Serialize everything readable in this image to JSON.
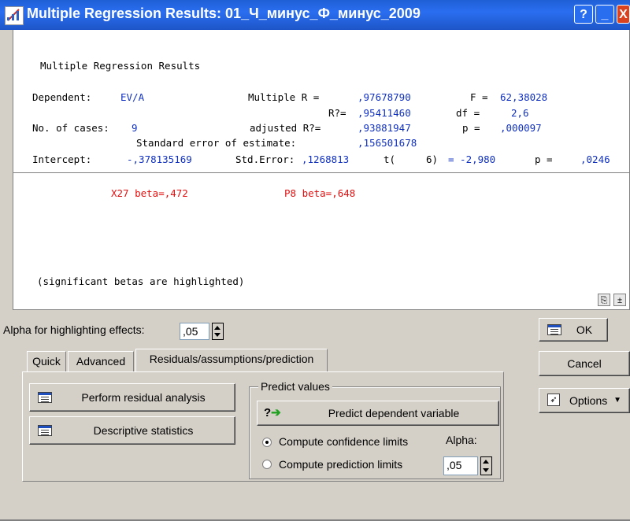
{
  "window": {
    "title": "Multiple Regression Results: 01_Ч_минус_Ф_минус_2009",
    "help": "?",
    "minimize": "_",
    "close": "X"
  },
  "output": {
    "header": "Multiple Regression Results",
    "dependent_label": "Dependent:",
    "dependent_value": "EV/A",
    "multiple_r_label": "Multiple R =",
    "multiple_r_value": ",97678790",
    "f_label": "F =",
    "f_value": "62,38028",
    "r2_label": "R?=",
    "r2_value": ",95411460",
    "df_label": "df =",
    "df_value": "2,6",
    "cases_label": "No. of cases:",
    "cases_value": "9",
    "adj_r2_label": "adjusted R?=",
    "adj_r2_value": ",93881947",
    "p_label": "p =",
    "p_value": ",000097",
    "se_label": "Standard error of estimate:",
    "se_value": ",156501678",
    "intercept_label": "Intercept:",
    "intercept_value": "-,378135169",
    "std_error_label": "Std.Error:",
    "std_error_value": ",1268813",
    "t_label": "t(",
    "t_df": "6)",
    "t_value": "= -2,980",
    "p2_label": "p =",
    "p2_value": ",0246",
    "beta1": "X27 beta=,472",
    "beta2": "P8 beta=,648",
    "footnote": "(significant betas are highlighted)"
  },
  "alpha_highlight": {
    "label": "Alpha for highlighting effects:",
    "value": ",05"
  },
  "tabs": [
    {
      "label": "Quick",
      "active": false
    },
    {
      "label": "Advanced",
      "active": false
    },
    {
      "label": "Residuals/assumptions/prediction",
      "active": true
    }
  ],
  "buttons": {
    "residual": "Perform residual analysis",
    "descriptive": "Descriptive statistics",
    "predict": "Predict dependent variable",
    "ok": "OK",
    "cancel": "Cancel",
    "options": "Options"
  },
  "predict_group": {
    "title": "Predict values",
    "confidence": "Compute confidence limits",
    "prediction": "Compute prediction limits",
    "alpha_label": "Alpha:",
    "alpha_value": ",05",
    "selected": "confidence"
  }
}
